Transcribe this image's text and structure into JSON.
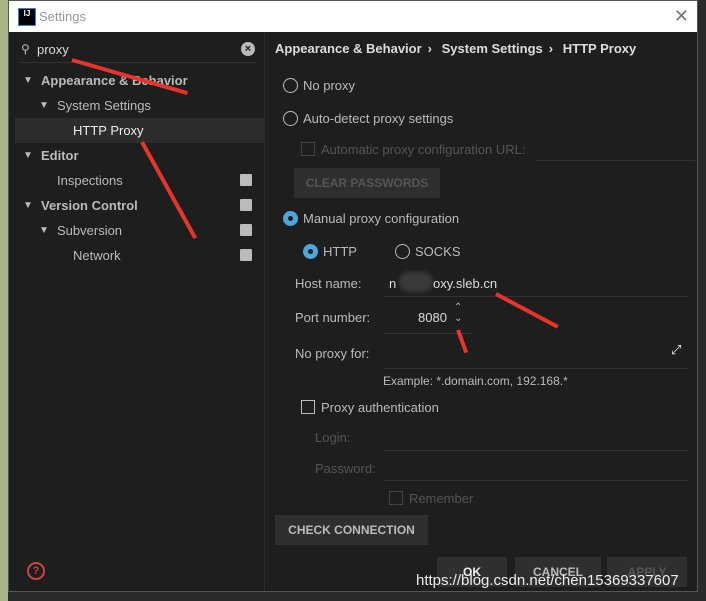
{
  "window": {
    "title": "Settings",
    "logo": "IJ"
  },
  "search": {
    "value": "proxy"
  },
  "tree": [
    {
      "label": "Appearance & Behavior",
      "bold": true
    },
    {
      "label": "System Settings"
    },
    {
      "label": "HTTP Proxy",
      "selected": true
    },
    {
      "label": "Editor",
      "bold": true
    },
    {
      "label": "Inspections"
    },
    {
      "label": "Version Control",
      "bold": true
    },
    {
      "label": "Subversion"
    },
    {
      "label": "Network"
    }
  ],
  "breadcrumb": [
    "Appearance & Behavior",
    "System Settings",
    "HTTP Proxy"
  ],
  "breadcrumb_sep": "›",
  "proxy": {
    "no_proxy": "No proxy",
    "auto_detect": "Auto-detect proxy settings",
    "auto_config_url": "Automatic proxy configuration URL:",
    "clear_passwords": "CLEAR PASSWORDS",
    "manual": "Manual proxy configuration",
    "http": "HTTP",
    "socks": "SOCKS",
    "host_label": "Host name:",
    "host_prefix": "n",
    "host_suffix": "oxy.sleb.cn",
    "port_label": "Port number:",
    "port_value": "8080",
    "no_proxy_for_label": "No proxy for:",
    "example": "Example: *.domain.com, 192.168.*",
    "proxy_auth": "Proxy authentication",
    "login_label": "Login:",
    "password_label": "Password:",
    "remember": "Remember",
    "selected_mode": "manual",
    "selected_type": "HTTP"
  },
  "buttons": {
    "check": "CHECK CONNECTION",
    "ok": "OK",
    "cancel": "CANCEL",
    "apply": "APPLY"
  },
  "watermark": "https://blog.csdn.net/chen15369337607",
  "colors": {
    "accent": "#4ea6dc",
    "arrow": "#e8342b",
    "background": "#1e1e1e"
  }
}
